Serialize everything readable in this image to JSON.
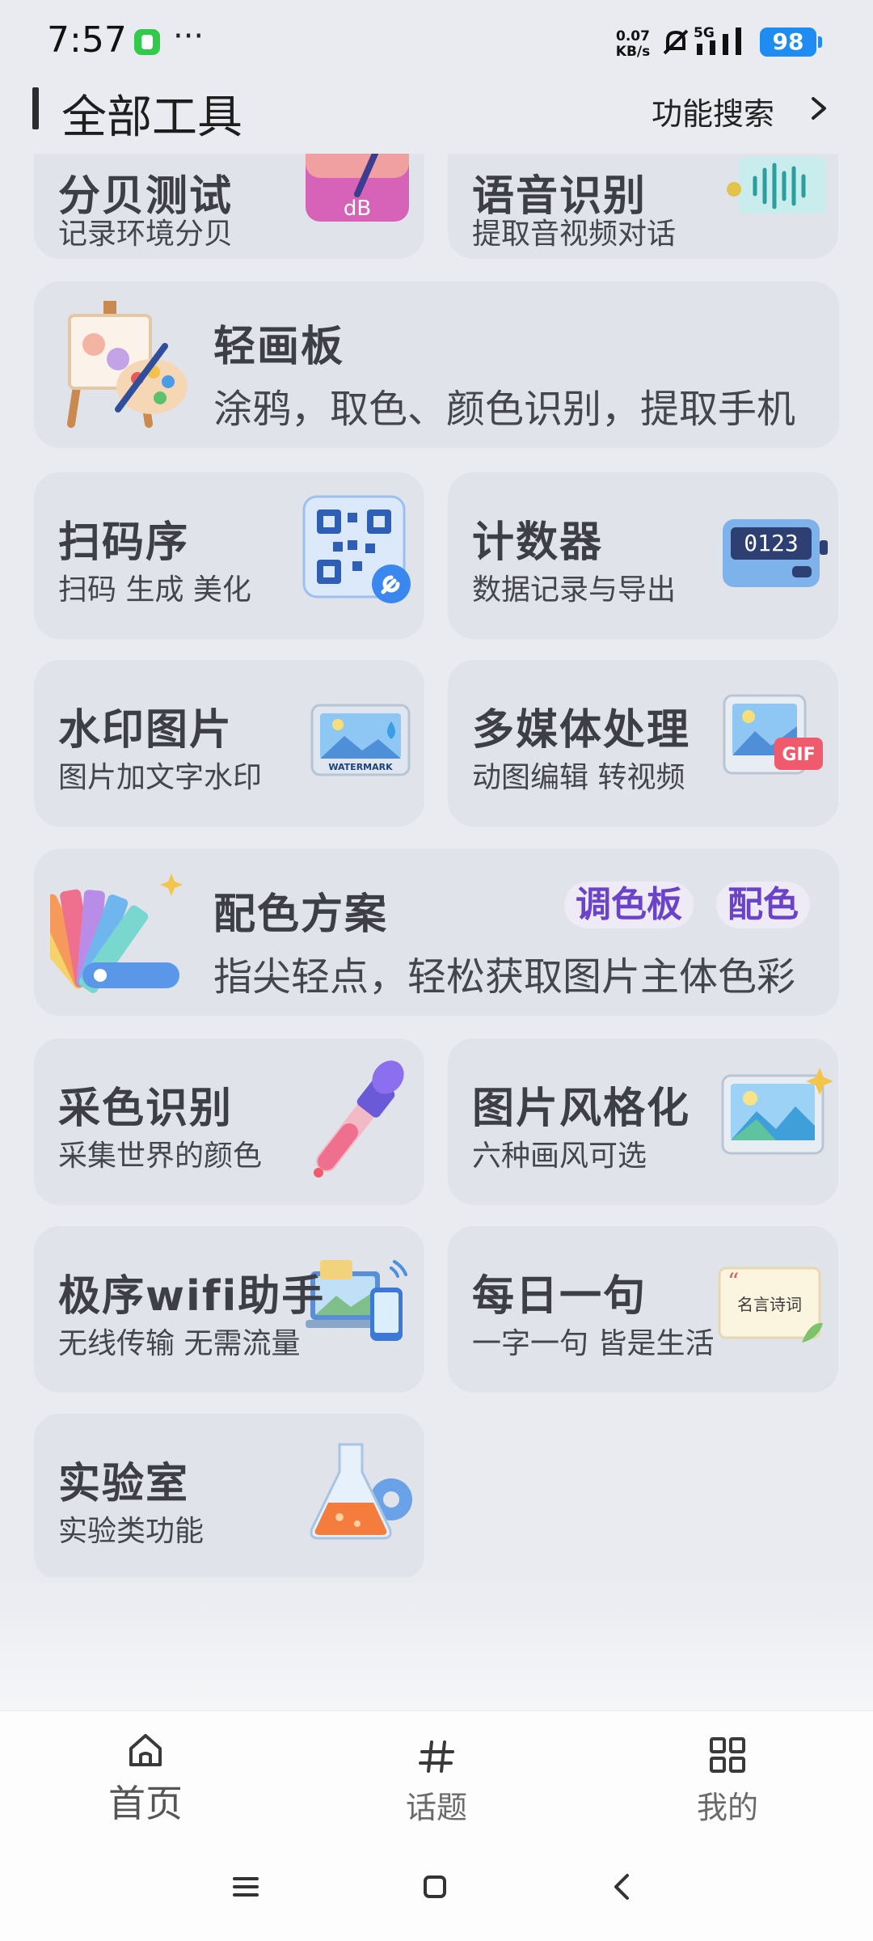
{
  "status_bar": {
    "time": "7:57",
    "more": "···",
    "speed_value": "0.07",
    "speed_unit": "KB/s",
    "network": "5G",
    "battery": "98"
  },
  "header": {
    "title": "全部工具",
    "search_label": "功能搜索"
  },
  "tools": [
    {
      "title": "分贝测试",
      "subtitle": "记录环境分贝",
      "icon": "decibel-meter-icon"
    },
    {
      "title": "语音识别",
      "subtitle": "提取音视频对话",
      "icon": "audio-waveform-icon"
    },
    {
      "title": "轻画板",
      "subtitle": "涂鸦，取色、颜色识别，提取手机",
      "icon": "easel-palette-icon"
    },
    {
      "title": "扫码序",
      "subtitle": "扫码 生成 美化",
      "icon": "qr-code-icon"
    },
    {
      "title": "计数器",
      "subtitle": "数据记录与导出",
      "icon": "counter-icon",
      "counter_digits": "0123"
    },
    {
      "title": "水印图片",
      "subtitle": "图片加文字水印",
      "icon": "watermark-image-icon",
      "badge": "WATERMARK"
    },
    {
      "title": "多媒体处理",
      "subtitle": "动图编辑 转视频",
      "icon": "gif-media-icon",
      "badge": "GIF"
    },
    {
      "title": "配色方案",
      "subtitle": "指尖轻点，轻松获取图片主体色彩",
      "icon": "color-swatches-icon",
      "tags": [
        "调色板",
        "配色"
      ]
    },
    {
      "title": "采色识别",
      "subtitle": "采集世界的颜色",
      "icon": "eyedropper-icon"
    },
    {
      "title": "图片风格化",
      "subtitle": "六种画风可选",
      "icon": "landscape-style-icon"
    },
    {
      "title": "极序wifi助手",
      "subtitle": "无线传输 无需流量",
      "icon": "wifi-transfer-icon"
    },
    {
      "title": "每日一句",
      "subtitle": "一字一句 皆是生活",
      "icon": "quote-card-icon",
      "badge": "名言诗词"
    },
    {
      "title": "实验室",
      "subtitle": "实验类功能",
      "icon": "lab-flask-icon"
    }
  ],
  "bottom_nav": [
    {
      "label": "首页",
      "icon": "home-icon",
      "active": true
    },
    {
      "label": "话题",
      "icon": "hashtag-icon",
      "active": false
    },
    {
      "label": "我的",
      "icon": "grid-icon",
      "active": false
    }
  ],
  "colors": {
    "background": "#e9ebf0",
    "card": "#e1e3ea",
    "accent_purple": "#6a43c8",
    "battery": "#1f8cf2"
  }
}
